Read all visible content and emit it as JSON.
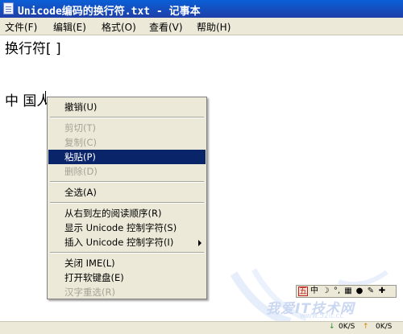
{
  "window": {
    "title": "Unicode编码的换行符.txt - 记事本"
  },
  "menubar": [
    "文件(F)",
    "编辑(E)",
    "格式(O)",
    "查看(V)",
    "帮助(H)"
  ],
  "editor": {
    "line1": "换行符[ ]",
    "line2": "中 国人"
  },
  "context_menu": {
    "items": [
      {
        "label": "撤销(U)",
        "enabled": true
      },
      {
        "label": "剪切(T)",
        "enabled": false
      },
      {
        "label": "复制(C)",
        "enabled": false
      },
      {
        "label": "粘贴(P)",
        "enabled": true,
        "highlighted": true
      },
      {
        "label": "删除(D)",
        "enabled": false
      },
      {
        "label": "全选(A)",
        "enabled": true
      },
      {
        "label": "从右到左的阅读顺序(R)",
        "enabled": true
      },
      {
        "label": "显示 Unicode 控制字符(S)",
        "enabled": true
      },
      {
        "label": "插入 Unicode 控制字符(I)",
        "enabled": true,
        "submenu": true
      },
      {
        "label": "关闭 IME(L)",
        "enabled": true
      },
      {
        "label": "打开软键盘(E)",
        "enabled": true
      },
      {
        "label": "汉字重选(R)",
        "enabled": false
      }
    ]
  },
  "ime_bar": {
    "mode": "五",
    "lang": "中"
  },
  "watermark": {
    "text": "我爱IT技术网",
    "url": "www.52it.cc"
  },
  "net_speed": {
    "down": "0K/S",
    "up": "0K/S"
  },
  "colors": {
    "title_bar": "#1f3fa8",
    "highlight": "#0a246a",
    "menu_bg": "#ece9d8"
  }
}
